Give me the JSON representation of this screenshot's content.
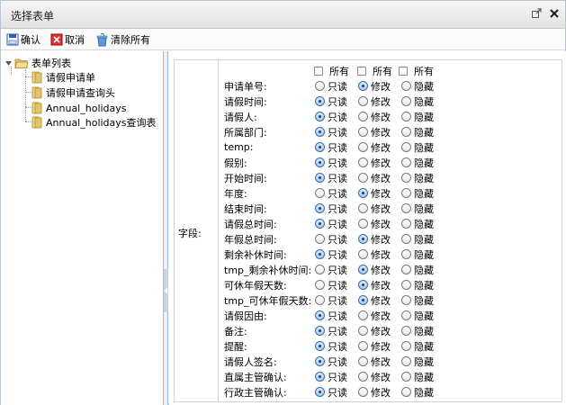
{
  "dialog": {
    "title": "选择表单"
  },
  "toolbar": {
    "confirm": "确认",
    "cancel": "取消",
    "clear_all": "清除所有"
  },
  "tree": {
    "root": "表单列表",
    "items": [
      "请假申请单",
      "请假申请查询头",
      "Annual_holidays",
      "Annual_holidays查询表"
    ]
  },
  "form": {
    "field_label": "字段:",
    "header": [
      "所有",
      "所有",
      "所有"
    ],
    "options": [
      "只读",
      "修改",
      "隐藏"
    ],
    "fields": [
      {
        "name": "申请单号:",
        "selected": 1
      },
      {
        "name": "请假时间:",
        "selected": 0
      },
      {
        "name": "请假人:",
        "selected": 0
      },
      {
        "name": "所属部门:",
        "selected": 0
      },
      {
        "name": "temp:",
        "selected": 0
      },
      {
        "name": "假别:",
        "selected": 0
      },
      {
        "name": "开始时间:",
        "selected": 0
      },
      {
        "name": "年度:",
        "selected": 1
      },
      {
        "name": "结束时间:",
        "selected": 0
      },
      {
        "name": "请假总时间:",
        "selected": 0
      },
      {
        "name": "年假总时间:",
        "selected": 1
      },
      {
        "name": "剩余补休时间:",
        "selected": 0
      },
      {
        "name": "tmp_剩余补休时间:",
        "selected": 1
      },
      {
        "name": "可休年假天数:",
        "selected": 1
      },
      {
        "name": "tmp_可休年假天数:",
        "selected": 1
      },
      {
        "name": "请假因由:",
        "selected": 0
      },
      {
        "name": "备注:",
        "selected": 0
      },
      {
        "name": "提醒:",
        "selected": 0
      },
      {
        "name": "请假人签名:",
        "selected": 0
      },
      {
        "name": "直属主管确认:",
        "selected": 0
      },
      {
        "name": "行政主管确认:",
        "selected": 0
      }
    ]
  }
}
